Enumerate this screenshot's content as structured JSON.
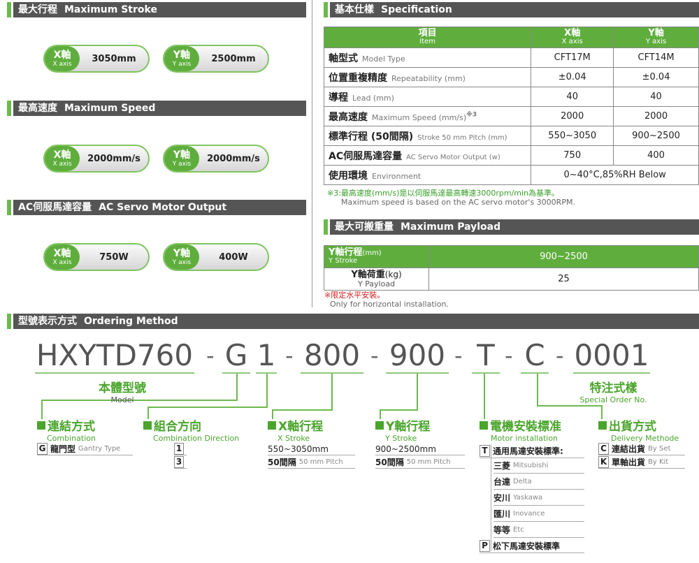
{
  "stroke": {
    "cn": "最大行程",
    "en": "Maximum Stroke",
    "x": "3050mm",
    "y": "2500mm"
  },
  "speed": {
    "cn": "最高速度",
    "en": "Maximum Speed",
    "x": "2000mm/s",
    "y": "2000mm/s"
  },
  "output": {
    "cn": "AC伺服馬達容量",
    "en": "AC Servo Motor Output",
    "x": "750W",
    "y": "400W"
  },
  "axis": {
    "x_cn": "X軸",
    "x_en": "X axis",
    "y_cn": "Y軸",
    "y_en": "Y axis"
  },
  "spec": {
    "cn": "基本仕樣",
    "en": "Specification",
    "h_item_cn": "項目",
    "h_item_en": "Item",
    "rows": [
      {
        "cn": "軸型式",
        "en": "Model Type",
        "x": "CFT17M",
        "y": "CFT14M"
      },
      {
        "cn": "位置重複精度",
        "en": "Repeatability (mm)",
        "x": "±0.04",
        "y": "±0.04"
      },
      {
        "cn": "導程",
        "en": "Lead (mm)",
        "x": "40",
        "y": "40"
      },
      {
        "cn": "最高速度",
        "en": "Maximum Speed (mm/s)",
        "sup": "※3",
        "x": "2000",
        "y": "2000"
      },
      {
        "cn": "標準行程 (50間隔)",
        "en": "Stroke 50 mm Pitch (mm)",
        "x": "550~3050",
        "y": "900~2500"
      },
      {
        "cn": "AC伺服馬達容量",
        "en": "AC Servo Motor Output (w)",
        "x": "750",
        "y": "400"
      },
      {
        "cn": "使用環境",
        "en": "Environment",
        "xy": "0~40°C,85%RH Below"
      }
    ],
    "note1": "※3:最高速度(mm/s)是以伺服馬達最高轉速3000rpm/min為基準。",
    "note2": "Maximum speed is based on the AC servo motor's 3000RPM."
  },
  "payload": {
    "cn": "最大可搬重量",
    "en": "Maximum Payload",
    "r1_cn": "Y軸行程",
    "r1_unit": "(mm)",
    "r1_en": "Y Stroke",
    "r1_val": "900~2500",
    "r2_cn": "Y軸荷重",
    "r2_unit": "(kg)",
    "r2_en": "Y Payload",
    "r2_val": "25",
    "note1": "※限定水平安裝。",
    "note2": "Only for horizontal installation."
  },
  "ordering": {
    "cn": "型號表示方式",
    "en": "Ordering Method",
    "seg_model": "HXYTD760",
    "seg_g": "G",
    "seg_1": "1",
    "seg_800": "800",
    "seg_900": "900",
    "seg_t": "T",
    "seg_c": "C",
    "seg_0001": "0001",
    "dash": "-",
    "model_cn": "本體型號",
    "model_en": "Model",
    "special_cn": "特注式樣",
    "special_en": "Special Order No.",
    "comb_cn": "連結方式",
    "comb_en": "Combination",
    "comb_k": "G",
    "comb_v": "龍門型",
    "comb_ve": "Gantry Type",
    "dir_cn": "組合方向",
    "dir_en": "Combination Direction",
    "dir_1": "1",
    "dir_3": "3",
    "xs_cn": "X軸行程",
    "xs_en": "X Stroke",
    "xs_v1": "550~3050mm",
    "xs_v2": "50間隔",
    "xs_v2e": "50 mm Pitch",
    "ys_cn": "Y軸行程",
    "ys_en": "Y Stroke",
    "ys_v1": "900~2500mm",
    "ys_v2": "50間隔",
    "ys_v2e": "50 mm Pitch",
    "mi_cn": "電機安裝標准",
    "mi_en": "Motor installation",
    "mi_t": "T",
    "mi_t_v": "通用馬達安裝標準:",
    "brands": [
      {
        "cn": "三菱",
        "en": "Mitsubishi"
      },
      {
        "cn": "台達",
        "en": "Delta"
      },
      {
        "cn": "安川",
        "en": "Yaskawa"
      },
      {
        "cn": "匯川",
        "en": "Inovance"
      },
      {
        "cn": "等等",
        "en": "Etc"
      }
    ],
    "mi_p": "P",
    "mi_p_v": "松下馬達安裝標準",
    "dm_cn": "出貨方式",
    "dm_en": "Delivery Methode",
    "dm_c": "C",
    "dm_c_v": "連結出貨",
    "dm_c_e": "By Set",
    "dm_k": "K",
    "dm_k_v": "單軸出貨",
    "dm_k_e": "By Kit"
  }
}
